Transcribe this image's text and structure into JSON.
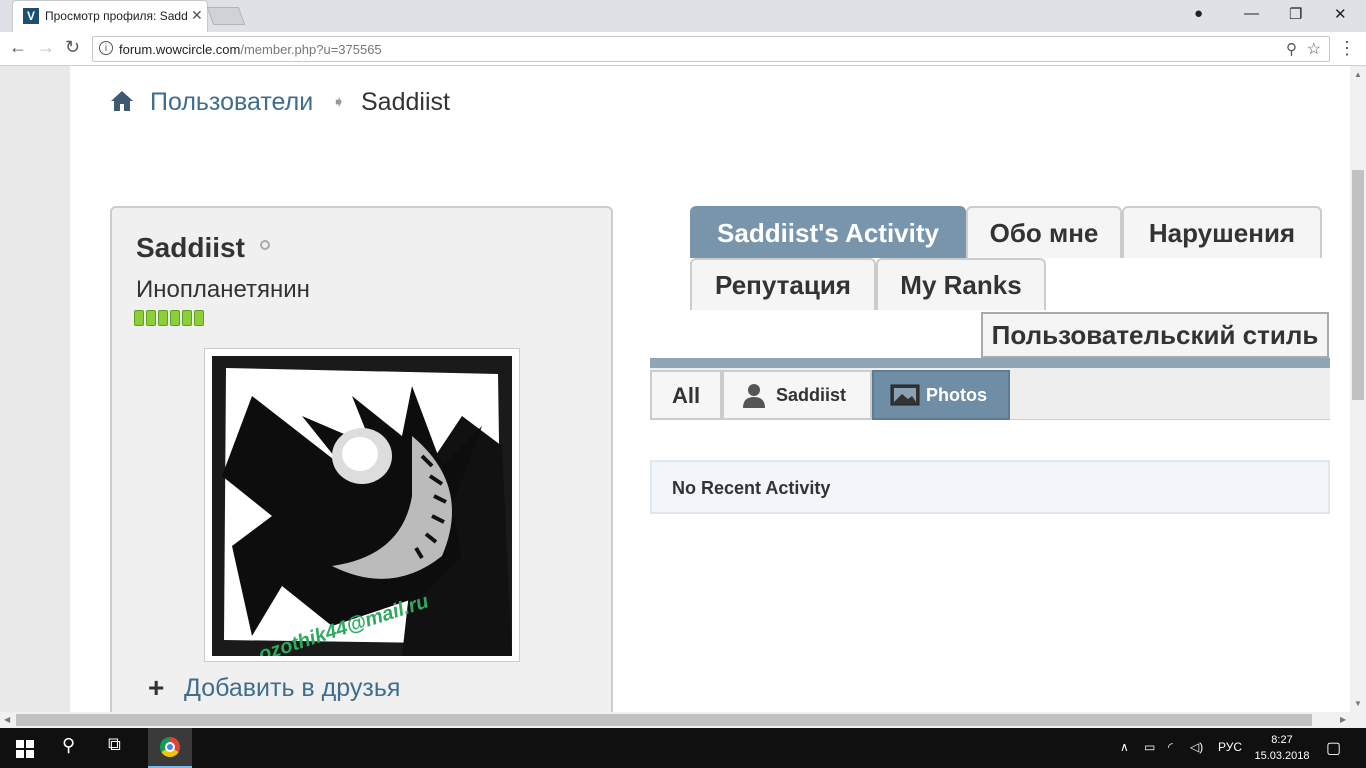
{
  "browser": {
    "tab_title": "Просмотр профиля: Saddiist",
    "url_domain": "forum.wowcircle.com",
    "url_rest": "/member.php?u=375565"
  },
  "breadcrumb": {
    "link": "Пользователи",
    "current": "Saddiist"
  },
  "profile": {
    "username": "Saddiist",
    "user_title": "Инопланетянин",
    "reputation_pips": 6,
    "avatar_watermark": "ozothik44@mail.ru",
    "add_friend": "Добавить в друзья"
  },
  "tabs": {
    "activity": "Saddiist's Activity",
    "about": "Обо мне",
    "infractions": "Нарушения",
    "reputation": "Репутация",
    "ranks": "My Ranks",
    "custom_style": "Пользовательский стиль"
  },
  "filters": {
    "all": "All",
    "user": "Saddiist",
    "photos": "Photos"
  },
  "activity": {
    "empty": "No Recent Activity"
  },
  "taskbar": {
    "lang": "РУС",
    "time": "8:27",
    "date": "15.03.2018"
  },
  "colors": {
    "accent": "#7895ab",
    "link": "#3e6d8e",
    "rep_green": "#8ccf3b"
  }
}
